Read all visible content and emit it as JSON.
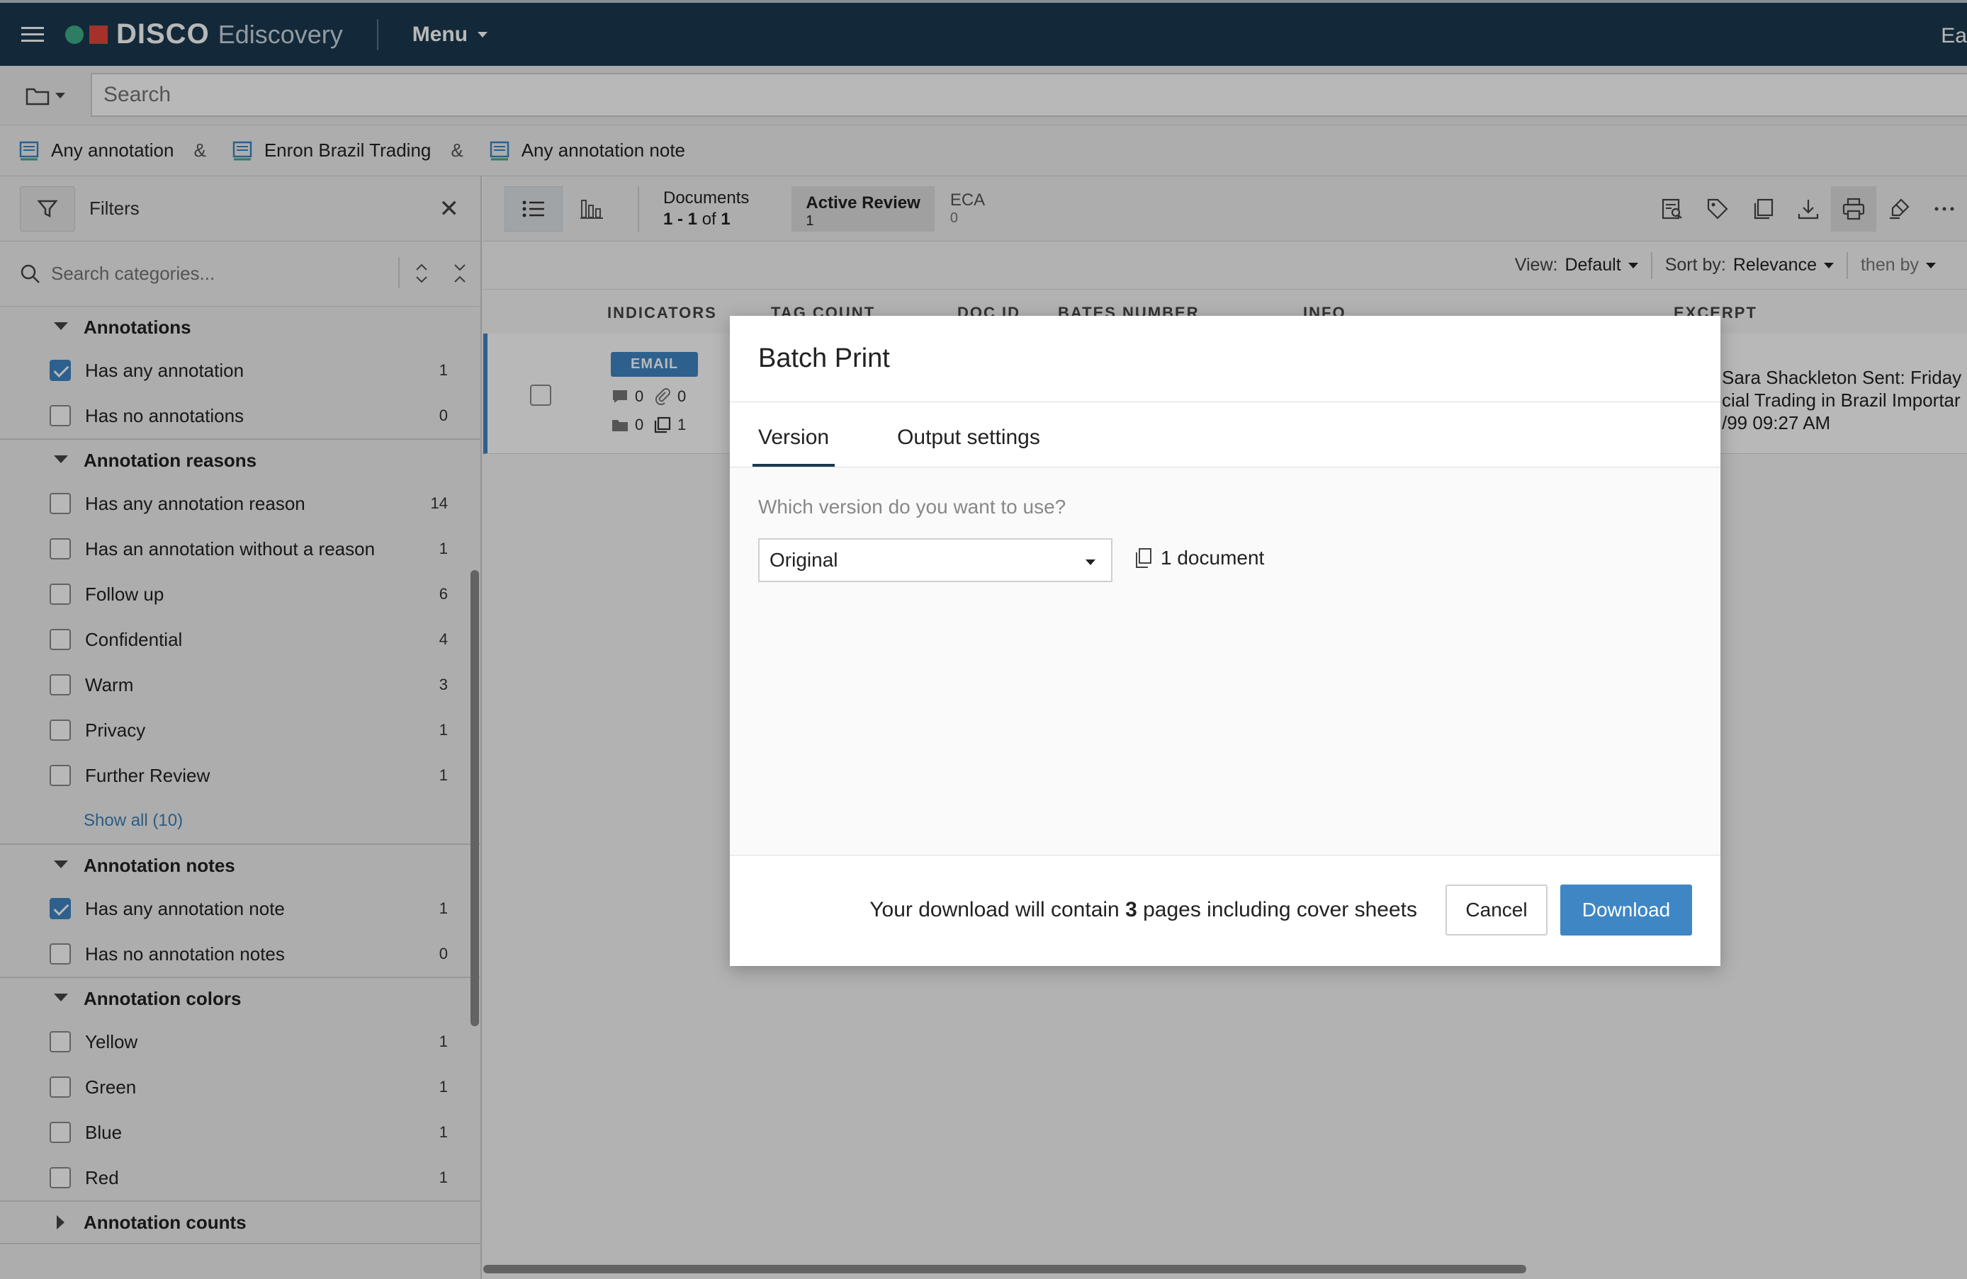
{
  "topbar": {
    "brand": "DISCO",
    "product": "Ediscovery",
    "menu_label": "Menu",
    "right_cut": "Ea"
  },
  "search": {
    "placeholder": "Search"
  },
  "chips": [
    {
      "label": "Any annotation"
    },
    {
      "label": "Enron Brazil Trading"
    },
    {
      "label": "Any annotation note"
    }
  ],
  "chip_separator": "&",
  "sidebar": {
    "title": "Filters",
    "category_search_placeholder": "Search categories...",
    "groups": [
      {
        "title": "Annotations",
        "items": [
          {
            "label": "Has any annotation",
            "count": "1",
            "checked": true
          },
          {
            "label": "Has no annotations",
            "count": "0",
            "checked": false
          }
        ]
      },
      {
        "title": "Annotation reasons",
        "items": [
          {
            "label": "Has any annotation reason",
            "count": "14",
            "checked": false
          },
          {
            "label": "Has an annotation without a reason",
            "count": "1",
            "checked": false
          },
          {
            "label": "Follow up",
            "count": "6",
            "checked": false
          },
          {
            "label": "Confidential",
            "count": "4",
            "checked": false
          },
          {
            "label": "Warm",
            "count": "3",
            "checked": false
          },
          {
            "label": "Privacy",
            "count": "1",
            "checked": false
          },
          {
            "label": "Further Review",
            "count": "1",
            "checked": false
          }
        ],
        "show_all": "Show all (10)"
      },
      {
        "title": "Annotation notes",
        "items": [
          {
            "label": "Has any annotation note",
            "count": "1",
            "checked": true
          },
          {
            "label": "Has no annotation notes",
            "count": "0",
            "checked": false
          }
        ]
      },
      {
        "title": "Annotation colors",
        "items": [
          {
            "label": "Yellow",
            "count": "1",
            "checked": false
          },
          {
            "label": "Green",
            "count": "1",
            "checked": false
          },
          {
            "label": "Blue",
            "count": "1",
            "checked": false
          },
          {
            "label": "Red",
            "count": "1",
            "checked": false
          }
        ]
      },
      {
        "title": "Annotation counts",
        "items": [],
        "collapsed": true
      }
    ]
  },
  "toolbar": {
    "documents_label": "Documents",
    "range": "1 - 1",
    "of": "of",
    "total": "1",
    "active_review_label": "Active Review",
    "active_review_count": "1",
    "eca_label": "ECA",
    "eca_count": "0"
  },
  "viewrow": {
    "view_label": "View:",
    "view_value": "Default",
    "sort_label": "Sort by:",
    "sort_value": "Relevance",
    "then_by": "then by"
  },
  "columns": {
    "indicators": "INDICATORS",
    "tag_count": "TAG COUNT",
    "doc_id": "DOC ID",
    "bates": "BATES NUMBER",
    "info": "INFO",
    "excerpt": "EXCERPT"
  },
  "doc": {
    "badge": "EMAIL",
    "comments": "0",
    "attachments": "0",
    "folders": "0",
    "copies": "1",
    "excerpt_lines": [
      "Sara Shackleton Sent: Friday",
      "cial Trading in Brazil Importar",
      "/99 09:27 AM"
    ]
  },
  "modal": {
    "title": "Batch Print",
    "tabs": [
      "Version",
      "Output settings"
    ],
    "question": "Which version do you want to use?",
    "version_value": "Original",
    "doc_count": "1 document",
    "foot_pre": "Your download will contain ",
    "foot_pages": "3",
    "foot_post": " pages including cover sheets",
    "cancel": "Cancel",
    "download": "Download"
  },
  "colors": {
    "navy": "#1b3a4f",
    "accent": "#3f86c4",
    "green": "#3fae8a",
    "red": "#e4463b"
  }
}
